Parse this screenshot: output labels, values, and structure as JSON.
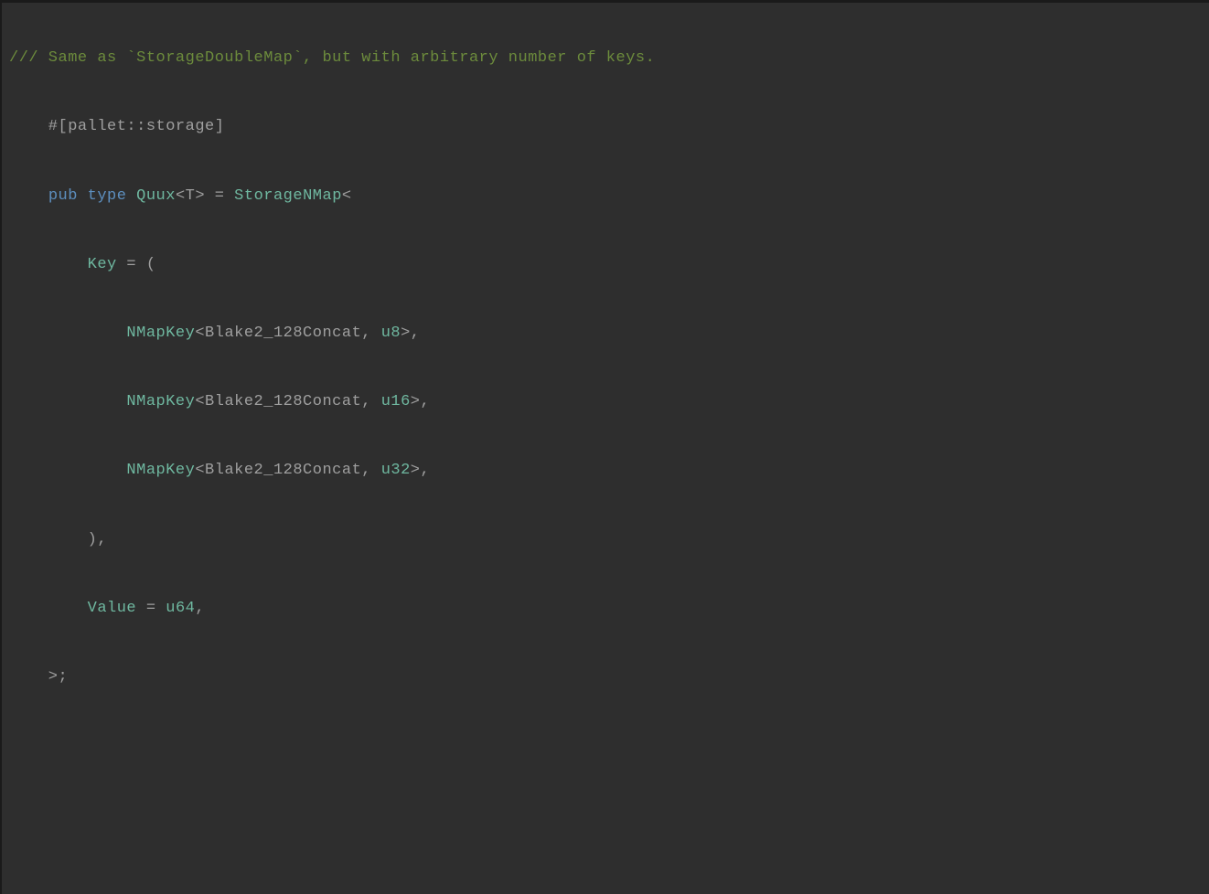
{
  "code": {
    "comment": "/// Same as `StorageDoubleMap`, but with arbitrary number of keys.",
    "attr": "    #[pallet::storage]",
    "pub": "pub",
    "type_kw": "type",
    "quux": "Quux",
    "t_param": "<T>",
    "eq1": " = ",
    "storage_nmap": "StorageNMap",
    "lt": "<",
    "key_label": "Key",
    "eq2": " = (",
    "nmapkey": "NMapKey",
    "blake": "<Blake2_128Concat, ",
    "u8": "u8",
    "u16": "u16",
    "u32": "u32",
    "close_key": ">,",
    "close_tuple": "        ),",
    "value_label": "Value",
    "eq3": " = ",
    "u64": "u64",
    "comma": ",",
    "close_gt": "    >;"
  }
}
